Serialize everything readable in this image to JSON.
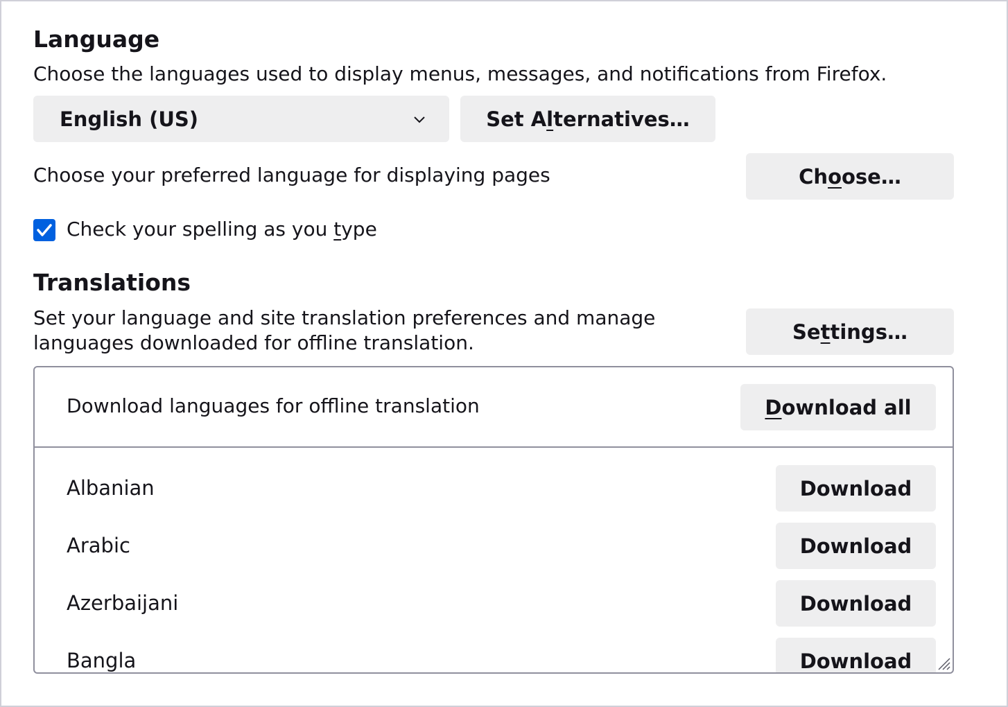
{
  "language": {
    "heading": "Language",
    "description": "Choose the languages used to display menus, messages, and notifications from Firefox.",
    "selected_language": "English (US)",
    "set_alternatives": {
      "before": "Set A",
      "accesskey": "l",
      "after": "ternatives…"
    },
    "preferred_label": "Choose your preferred language for displaying pages",
    "choose": {
      "before": "Ch",
      "accesskey": "o",
      "after": "ose…"
    },
    "spellcheck": {
      "before": "Check your spelling as you ",
      "accesskey": "t",
      "after": "ype",
      "checked": true
    }
  },
  "translations": {
    "heading": "Translations",
    "description_line1": "Set your language and site translation preferences and manage",
    "description_line2": "languages downloaded for offline translation.",
    "settings": {
      "before": "Se",
      "accesskey": "t",
      "after": "tings…"
    },
    "download_header": "Download languages for offline translation",
    "download_all": {
      "before": "",
      "accesskey": "D",
      "after": "ownload all"
    },
    "languages": [
      {
        "name": "Albanian",
        "action": "Download"
      },
      {
        "name": "Arabic",
        "action": "Download"
      },
      {
        "name": "Azerbaijani",
        "action": "Download"
      },
      {
        "name": "Bangla",
        "action": "Download"
      }
    ]
  },
  "colors": {
    "accent": "#0060df",
    "button_bg": "#eeeeef",
    "border": "#8f8f9d"
  },
  "icons": [
    "chevron-down-icon",
    "checkmark-icon",
    "resize-grip-icon"
  ]
}
